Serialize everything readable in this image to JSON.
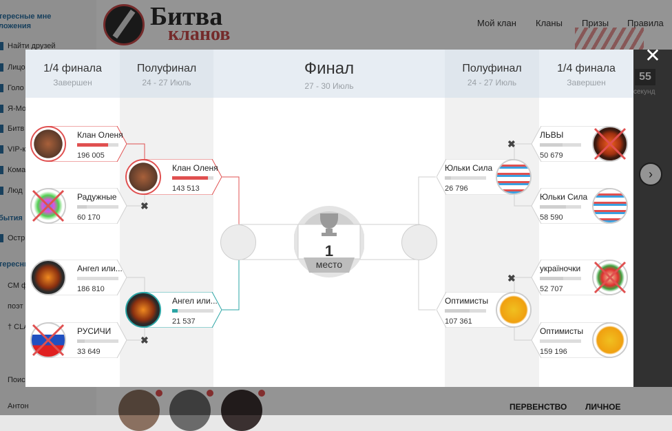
{
  "background": {
    "logo_line1": "Битва",
    "logo_line2": "кланов",
    "nav": [
      "Мой клан",
      "Кланы",
      "Призы",
      "Правила"
    ],
    "sidebar_sections": [
      "тересные мне",
      "ложения",
      "бытия",
      "тересные"
    ],
    "sidebar_items": [
      "Найти друзей",
      "Лицо",
      "Голо",
      "Я-Мо",
      "Битв",
      "VIP-к",
      "Кома",
      "Люд",
      "Остр",
      "СМ ф",
      "поэт",
      "† CLA",
      "Поиск",
      "Антон"
    ],
    "timer_value": "55",
    "timer_label": "секунд",
    "bottom_labels": [
      "ПЕРВЕНСТВО",
      "ЛИЧНОЕ"
    ],
    "next_arrow": "chevron-right-icon"
  },
  "rounds": {
    "left_quarter": {
      "title": "1/4 финала",
      "subtitle": "Завершен"
    },
    "left_semi": {
      "title": "Полуфинал",
      "subtitle": "24 - 27 Июль"
    },
    "final": {
      "title": "Финал",
      "subtitle": "27 - 30 Июль"
    },
    "right_semi": {
      "title": "Полуфинал",
      "subtitle": "24 - 27 Июль"
    },
    "right_quarter": {
      "title": "1/4 финала",
      "subtitle": "Завершен"
    }
  },
  "podium": {
    "place": "1",
    "label": "место",
    "icon": "trophy-icon"
  },
  "close_icon": "close-icon",
  "teams": {
    "lq1": {
      "name": "Клан Оленя",
      "score": "196 005",
      "progress": 0.75,
      "eliminated": false
    },
    "lq2": {
      "name": "Радужные",
      "score": "60 170",
      "progress": 0.23,
      "eliminated": true
    },
    "lq3": {
      "name": "Ангел или...",
      "score": "186 810",
      "progress": 0.0,
      "eliminated": false
    },
    "lq4": {
      "name": "РУСИЧИ",
      "score": "33 649",
      "progress": 0.18,
      "eliminated": true
    },
    "ls1": {
      "name": "Клан Оленя",
      "score": "143 513",
      "progress": 0.86
    },
    "ls2": {
      "name": "Ангел или...",
      "score": "21 537",
      "progress": 0.13
    },
    "rs1": {
      "name": "Юльки Сила",
      "score": "26 796",
      "progress": 0.15
    },
    "rs2": {
      "name": "Оптимисты",
      "score": "107 361",
      "progress": 0.6
    },
    "rq1": {
      "name": "ЛЬВЫ",
      "score": "50 679",
      "progress": 0.55,
      "eliminated": true
    },
    "rq2": {
      "name": "Юльки Сила",
      "score": "58 590",
      "progress": 0.63,
      "eliminated": false
    },
    "rq3": {
      "name": "україночки",
      "score": "52 707",
      "progress": 0.56,
      "eliminated": true
    },
    "rq4": {
      "name": "Оптимисты",
      "score": "159 196",
      "progress": 0.0,
      "eliminated": false
    }
  },
  "colors": {
    "accent_red": "#e05050",
    "accent_teal": "#2aa4a4",
    "header_bg": "#e7edf3"
  }
}
